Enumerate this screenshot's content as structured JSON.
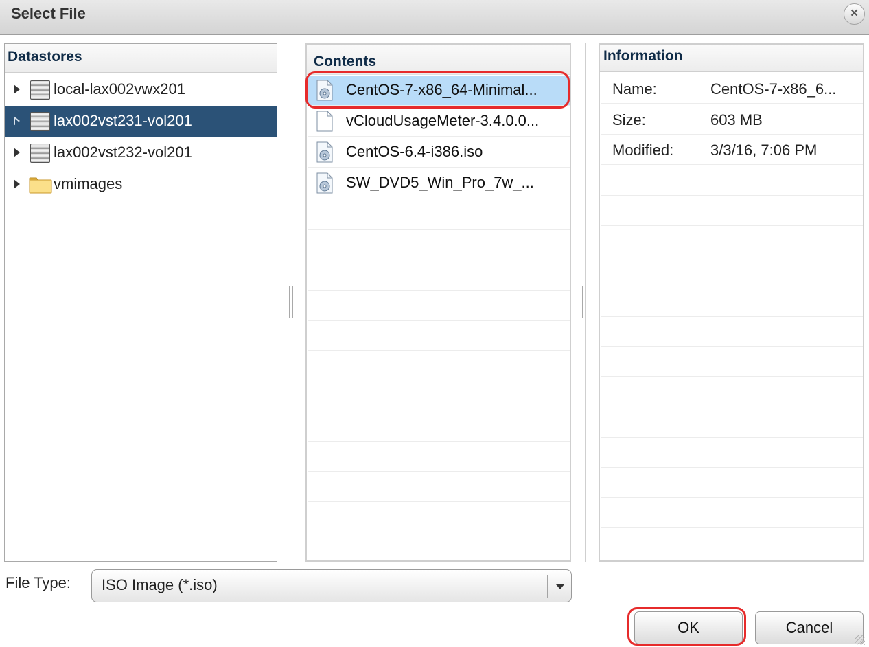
{
  "dialog": {
    "title": "Select File",
    "close_icon": "close-icon"
  },
  "datastores": {
    "header": "Datastores",
    "items": [
      {
        "label": "local-lax002vwx201",
        "icon": "database-icon",
        "selected": false
      },
      {
        "label": "lax002vst231-vol201",
        "icon": "database-icon",
        "selected": true
      },
      {
        "label": "lax002vst232-vol201",
        "icon": "database-icon",
        "selected": false
      },
      {
        "label": "vmimages",
        "icon": "folder-icon",
        "selected": false
      }
    ]
  },
  "contents": {
    "header": "Contents",
    "items": [
      {
        "label": "CentOS-7-x86_64-Minimal...",
        "icon": "disc-image-file-icon",
        "selected": true
      },
      {
        "label": "vCloudUsageMeter-3.4.0.0...",
        "icon": "file-icon",
        "selected": false
      },
      {
        "label": "CentOS-6.4-i386.iso",
        "icon": "disc-image-file-icon",
        "selected": false
      },
      {
        "label": "SW_DVD5_Win_Pro_7w_...",
        "icon": "disc-image-file-icon",
        "selected": false
      }
    ]
  },
  "information": {
    "header": "Information",
    "rows": [
      {
        "key": "Name:",
        "value": "CentOS-7-x86_6..."
      },
      {
        "key": "Size:",
        "value": "603 MB"
      },
      {
        "key": "Modified:",
        "value": "3/3/16, 7:06 PM"
      }
    ]
  },
  "file_type": {
    "label": "File Type:",
    "selected": "ISO Image (*.iso)"
  },
  "buttons": {
    "ok": "OK",
    "cancel": "Cancel"
  },
  "colors": {
    "selection_dark": "#2b5277",
    "selection_light": "#b9dcf8",
    "highlight": "#e62b2b",
    "header_text": "#0f2b47"
  }
}
